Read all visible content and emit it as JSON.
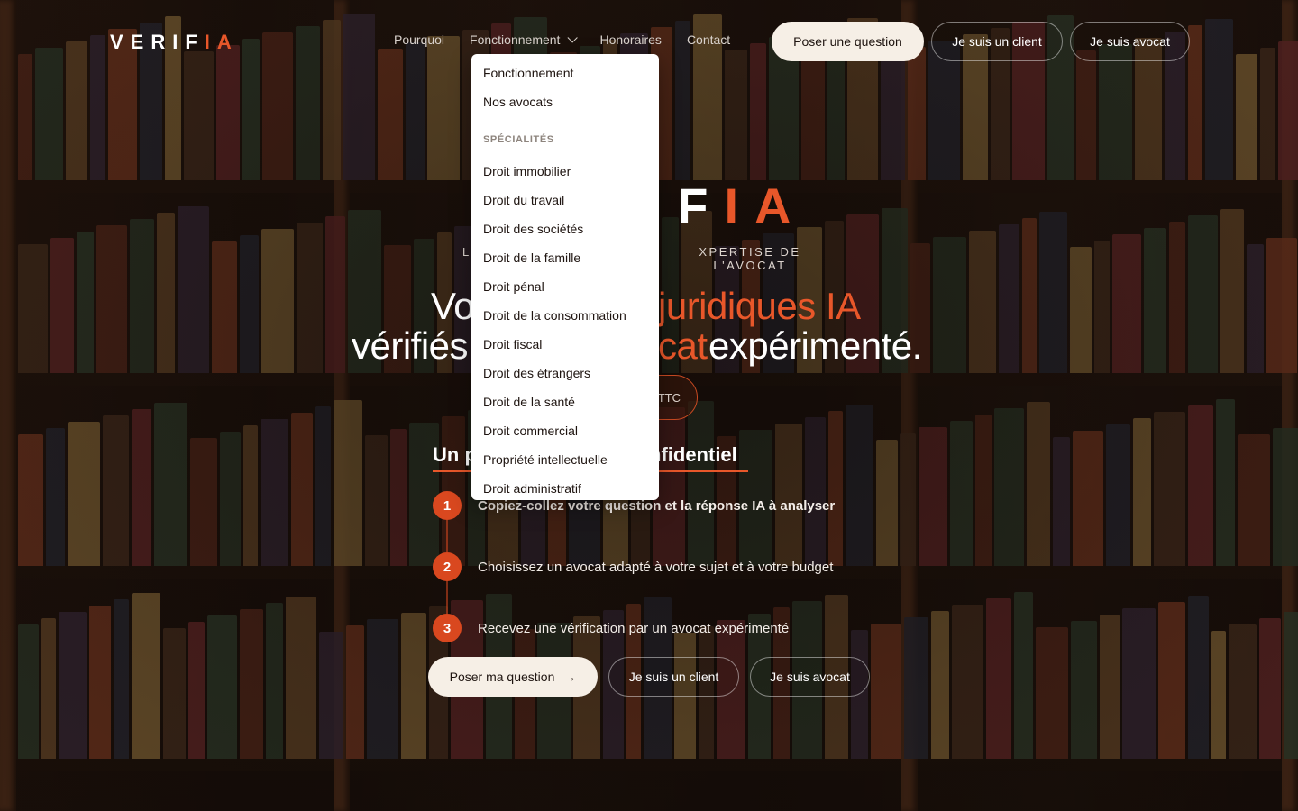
{
  "header": {
    "logo_main": "VERIF",
    "logo_accent": "IA",
    "nav": [
      "Pourquoi",
      "Fonctionnement",
      "Honoraires",
      "Contact"
    ],
    "btn_question": "Poser une question",
    "btn_client": "Je suis un client",
    "btn_avocat": "Je suis avocat"
  },
  "dropdown": {
    "top_items": [
      "Fonctionnement",
      "Nos avocats"
    ],
    "section_title": "SPÉCIALITÉS",
    "specialites": [
      "Droit immobilier",
      "Droit du travail",
      "Droit des sociétés",
      "Droit de la famille",
      "Droit pénal",
      "Droit de la consommation",
      "Droit fiscal",
      "Droit des étrangers",
      "Droit de la santé",
      "Droit commercial",
      "Propriété intellectuelle",
      "Droit administratif"
    ]
  },
  "hero": {
    "logo_main": "VERIF",
    "logo_accent": "IA",
    "tagline": "XPERTISE DE L'AVOCAT",
    "tagline_left": "L",
    "headline_l1_a": "Vo",
    "headline_l1_accent": "juridiques IA",
    "headline_l2_a": "vérifiés",
    "headline_l2_accent": "cat",
    "headline_l2_b": " expérimenté.",
    "price_tail": "TTC",
    "process_title": "Un p",
    "process_title_tail": "nfidentiel"
  },
  "steps": [
    {
      "num": "1",
      "text": "Copiez-collez votre question et la réponse IA à analyser"
    },
    {
      "num": "2",
      "text": "Choisissez un avocat adapté à votre sujet et à votre budget"
    },
    {
      "num": "3",
      "text": "Recevez une vérification par un avocat expérimenté"
    }
  ],
  "cta": {
    "primary": "Poser ma question",
    "client": "Je suis un client",
    "avocat": "Je suis avocat"
  },
  "colors": {
    "accent": "#e8572a",
    "cream": "#f6efe6",
    "background": "#2a1a12"
  }
}
